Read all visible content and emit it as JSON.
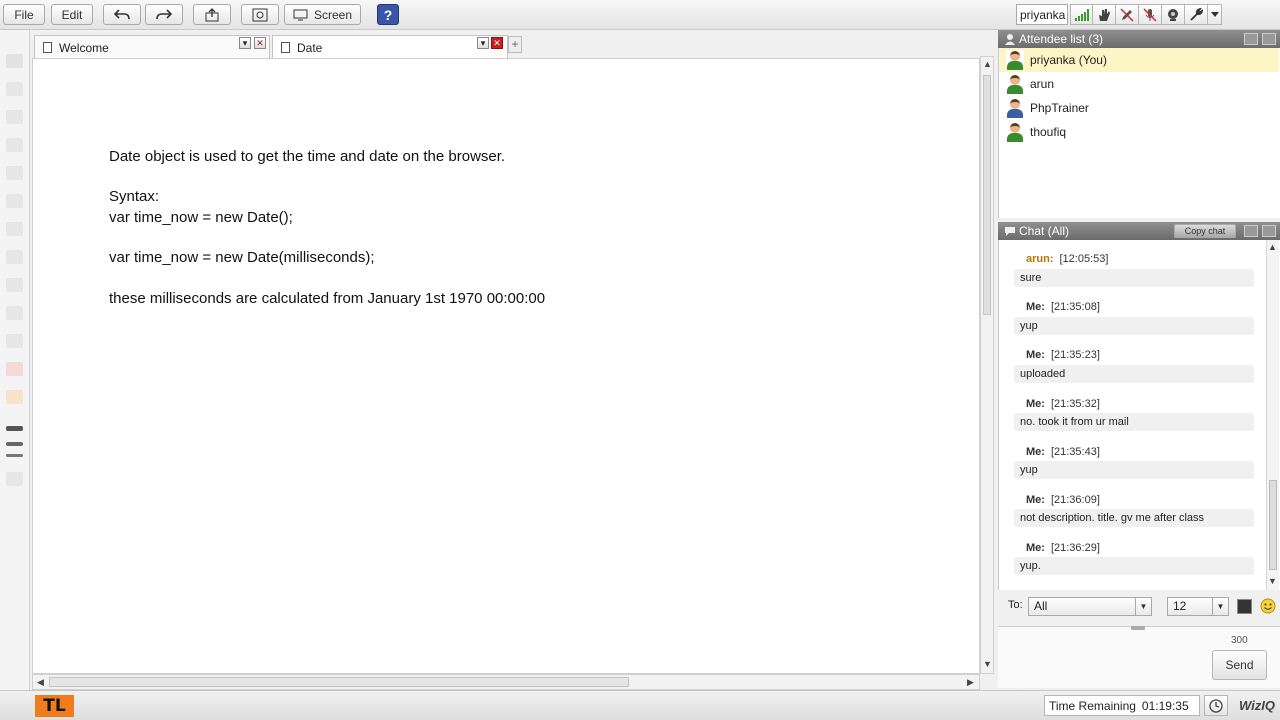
{
  "toolbar": {
    "file_label": "File",
    "edit_label": "Edit",
    "screen_label": "Screen",
    "help_label": "?",
    "username": "priyanka"
  },
  "tabs": [
    {
      "label": "Welcome"
    },
    {
      "label": "Date"
    }
  ],
  "whiteboard": {
    "lines": [
      "Date object is used to get the time and date on the browser.",
      "Syntax:",
      "var time_now = new Date();",
      "var time_now = new Date(milliseconds);",
      "these milliseconds are calculated from January 1st 1970 00:00:00"
    ]
  },
  "attendees": {
    "title": "Attendee list (3)",
    "people": [
      {
        "name": "priyanka (You)",
        "shirt_color": "#3a8a2e"
      },
      {
        "name": "arun",
        "shirt_color": "#3a8a2e"
      },
      {
        "name": "PhpTrainer",
        "shirt_color": "#3b5fa3"
      },
      {
        "name": "thoufiq",
        "shirt_color": "#3a8a2e"
      }
    ]
  },
  "chat": {
    "title": "Chat (All)",
    "copy_label": "Copy chat",
    "messages": [
      {
        "sender": "arun:",
        "time": "[12:05:53]",
        "text": "sure"
      },
      {
        "sender": "Me:",
        "time": "[21:35:08]",
        "text": "yup"
      },
      {
        "sender": "Me:",
        "time": "[21:35:23]",
        "text": "uploaded"
      },
      {
        "sender": "Me:",
        "time": "[21:35:32]",
        "text": "no. took it from ur mail"
      },
      {
        "sender": "Me:",
        "time": "[21:35:43]",
        "text": "yup"
      },
      {
        "sender": "Me:",
        "time": "[21:36:09]",
        "text": "not description. title. gv me after class"
      },
      {
        "sender": "Me:",
        "time": "[21:36:29]",
        "text": "yup."
      }
    ],
    "to_label": "To:",
    "to_value": "All",
    "font_size_value": "12",
    "char_limit": "300",
    "send_label": "Send"
  },
  "footer": {
    "logo_text": "TL",
    "time_remaining_label": "Time Remaining",
    "time_remaining_value": "01:19:35",
    "brand": "WizIQ"
  },
  "colors": {
    "sender_arun": "#b07800",
    "accent_orange": "#f07d1d",
    "panel_header": "#7a7a7a",
    "self_highlight": "#fdf5c5"
  }
}
